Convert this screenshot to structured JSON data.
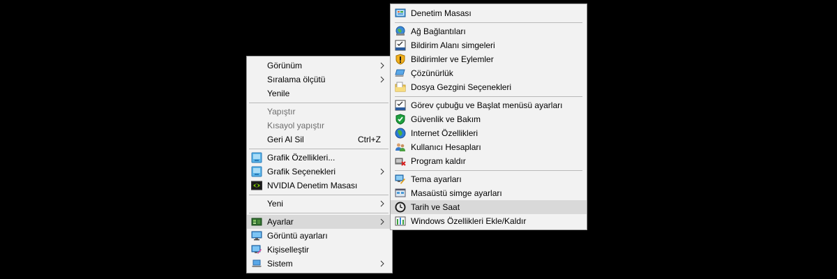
{
  "main_menu": {
    "items": [
      {
        "label": "Görünüm",
        "submenu": true
      },
      {
        "label": "Sıralama ölçütü",
        "submenu": true
      },
      {
        "label": "Yenile"
      },
      {
        "label": "Yapıştır",
        "disabled": true
      },
      {
        "label": "Kısayol yapıştır",
        "disabled": true
      },
      {
        "label": "Geri Al Sil",
        "shortcut": "Ctrl+Z"
      },
      {
        "label": "Grafik Özellikleri...",
        "icon": "intel-graphics-icon"
      },
      {
        "label": "Grafik Seçenekleri",
        "icon": "intel-graphics-icon",
        "submenu": true
      },
      {
        "label": "NVIDIA Denetim Masası",
        "icon": "nvidia-icon"
      },
      {
        "label": "Yeni",
        "submenu": true
      },
      {
        "label": "Ayarlar",
        "icon": "settings-board-icon",
        "submenu": true,
        "highlighted": true
      },
      {
        "label": "Görüntü ayarları",
        "icon": "display-icon"
      },
      {
        "label": "Kişiselleştir",
        "icon": "personalize-icon"
      },
      {
        "label": "Sistem",
        "icon": "laptop-icon",
        "submenu": true
      }
    ]
  },
  "sub_menu": {
    "items": [
      {
        "label": "Denetim Masası",
        "icon": "control-panel-icon"
      },
      {
        "label": "Ağ Bağlantıları",
        "icon": "network-globe-icon"
      },
      {
        "label": "Bildirim Alanı simgeleri",
        "icon": "tray-icon"
      },
      {
        "label": "Bildirimler ve Eylemler",
        "icon": "warning-shield-icon"
      },
      {
        "label": "Çözünürlük",
        "icon": "resolution-icon"
      },
      {
        "label": "Dosya Gezgini Seçenekleri",
        "icon": "folder-options-icon"
      },
      {
        "label": "Görev çubuğu ve Başlat menüsü ayarları",
        "icon": "taskbar-icon"
      },
      {
        "label": "Güvenlik ve Bakım",
        "icon": "security-shield-icon"
      },
      {
        "label": "Internet Özellikleri",
        "icon": "internet-globe-icon"
      },
      {
        "label": "Kullanıcı Hesapları",
        "icon": "users-icon"
      },
      {
        "label": "Program kaldır",
        "icon": "uninstall-icon"
      },
      {
        "label": "Tema ayarları",
        "icon": "theme-icon"
      },
      {
        "label": "Masaüstü simge ayarları",
        "icon": "desktop-icons-icon"
      },
      {
        "label": "Tarih ve Saat",
        "icon": "clock-icon",
        "highlighted": true
      },
      {
        "label": "Windows Özellikleri Ekle/Kaldır",
        "icon": "windows-features-icon"
      }
    ]
  }
}
